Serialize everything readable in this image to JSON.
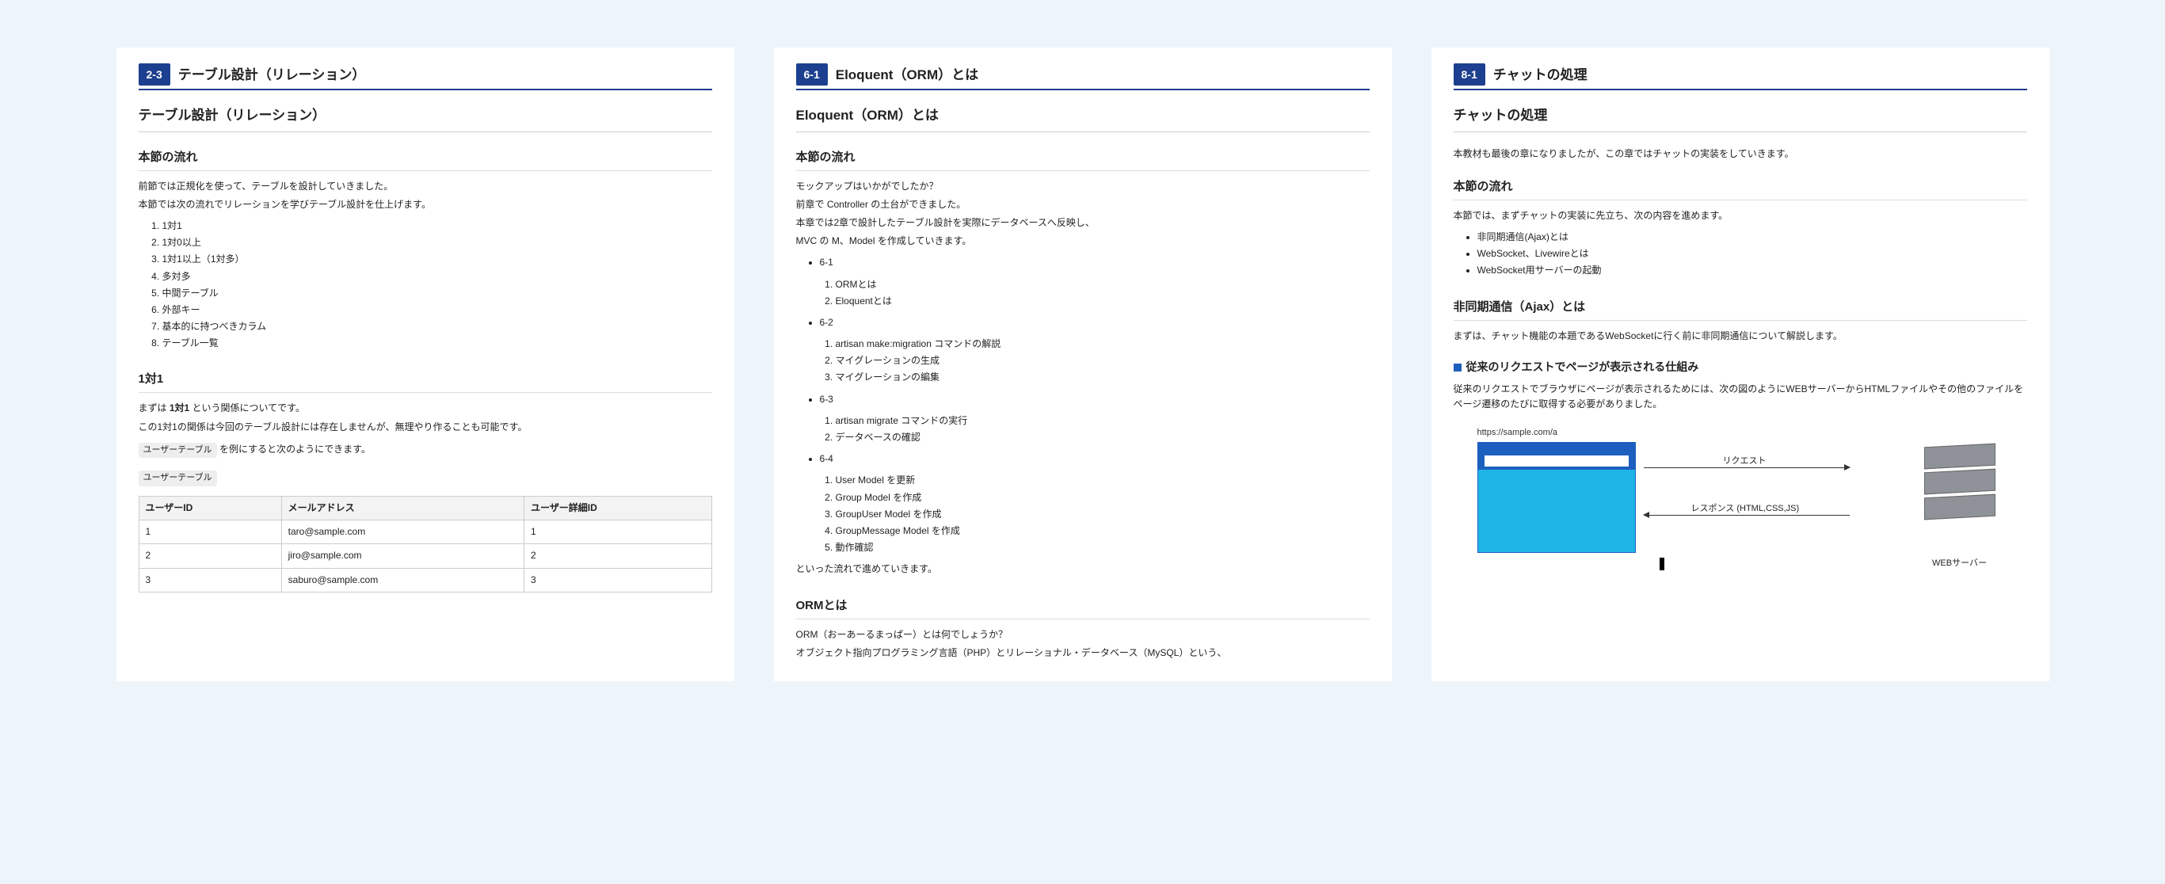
{
  "cards": [
    {
      "badge": "2-3",
      "title": "テーブル設計（リレーション）",
      "subtitle": "テーブル設計（リレーション）",
      "flow_heading": "本節の流れ",
      "intro": [
        "前節では正規化を使って、テーブルを設計していきました。",
        "本節では次の流れでリレーションを学びテーブル設計を仕上げます。"
      ],
      "flow_list": [
        "1対1",
        "1対0以上",
        "1対1以上（1対多）",
        "多対多",
        "中間テーブル",
        "外部キー",
        "基本的に持つべきカラム",
        "テーブル一覧"
      ],
      "sub_heading": "1対1",
      "sub_p1_a": "まずは ",
      "sub_p1_b": "1対1",
      "sub_p1_c": " という関係についてです。",
      "sub_p2": "この1対1の関係は今回のテーブル設計には存在しませんが、無理やり作ることも可能です。",
      "chip": "ユーザーテーブル",
      "sub_p3": " を例にすると次のようにできます。",
      "table_chip": "ユーザーテーブル",
      "table": {
        "headers": [
          "ユーザーID",
          "メールアドレス",
          "ユーザー詳細ID"
        ],
        "rows": [
          [
            "1",
            "taro@sample.com",
            "1"
          ],
          [
            "2",
            "jiro@sample.com",
            "2"
          ],
          [
            "3",
            "saburo@sample.com",
            "3"
          ]
        ]
      }
    },
    {
      "badge": "6-1",
      "title": "Eloquent（ORM）とは",
      "subtitle": "Eloquent（ORM）とは",
      "flow_heading": "本節の流れ",
      "intro": [
        "モックアップはいかがでしたか？",
        "前章で Controller の土台ができました。",
        "本章では2章で設計したテーブル設計を実際にデータベースへ反映し、",
        "MVC の M、Model を作成していきます。"
      ],
      "outline": [
        {
          "h": "6-1",
          "items": [
            "ORMとは",
            "Eloquentとは"
          ]
        },
        {
          "h": "6-2",
          "items": [
            "artisan make:migration コマンドの解説",
            "マイグレーションの生成",
            "マイグレーションの編集"
          ]
        },
        {
          "h": "6-3",
          "items": [
            "artisan migrate コマンドの実行",
            "データベースの確認"
          ]
        },
        {
          "h": "6-4",
          "items": [
            "User Model を更新",
            "Group Model を作成",
            "GroupUser Model を作成",
            "GroupMessage Model を作成",
            "動作確認"
          ]
        }
      ],
      "outro": "といった流れで進めていきます。",
      "sub_heading": "ORMとは",
      "orm_p1": "ORM（おーあーるまっぱー）とは何でしょうか？",
      "orm_p2": "オブジェクト指向プログラミング言語（PHP）とリレーショナル・データベース（MySQL）という、"
    },
    {
      "badge": "8-1",
      "title": "チャットの処理",
      "subtitle": "チャットの処理",
      "intro1": "本教材も最後の章になりましたが、この章ではチャットの実装をしていきます。",
      "flow_heading": "本節の流れ",
      "flow_intro": "本節では、まずチャットの実装に先立ち、次の内容を進めます。",
      "flow_list": [
        "非同期通信(Ajax)とは",
        "WebSocket、Livewireとは",
        "WebSocket用サーバーの起動"
      ],
      "sub_heading": "非同期通信（Ajax）とは",
      "sub_p1": "まずは、チャット機能の本題であるWebSocketに行く前に非同期通信について解説します。",
      "blue_head": "従来のリクエストでページが表示される仕組み",
      "blue_p": "従来のリクエストでブラウザにページが表示されるためには、次の図のようにWEBサーバーからHTMLファイルやその他のファイルをページ遷移のたびに取得する必要がありました。",
      "diagram": {
        "url": "https://sample.com/a",
        "req": "リクエスト",
        "res": "レスポンス (HTML,CSS,JS)",
        "server": "WEBサーバー"
      }
    }
  ]
}
